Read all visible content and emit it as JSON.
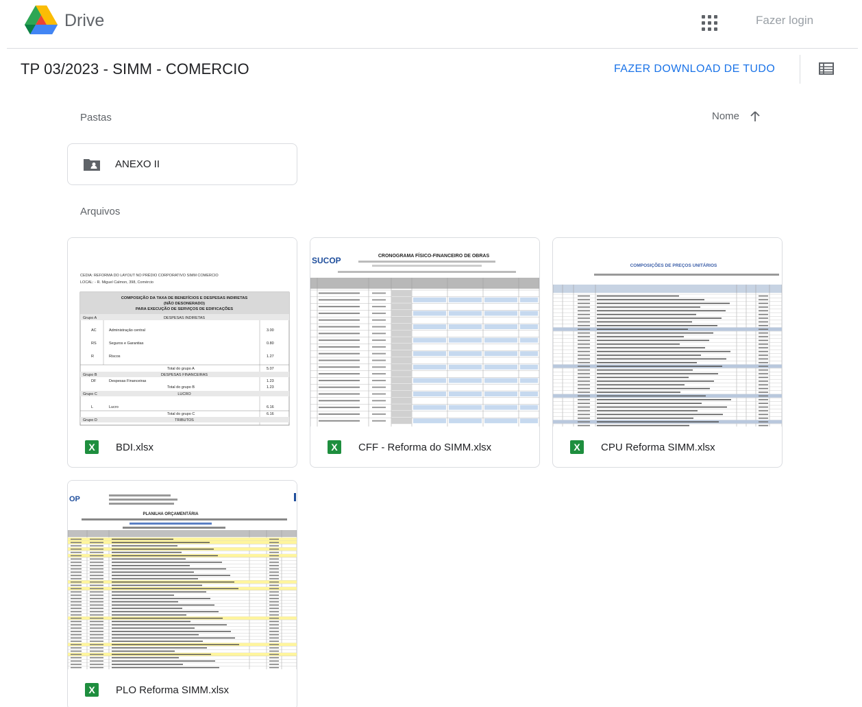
{
  "header": {
    "brand": "Drive",
    "login": "Fazer login"
  },
  "toolbar": {
    "title": "TP 03/2023 - SIMM - COMERCIO",
    "download_all": "FAZER DOWNLOAD DE TUDO"
  },
  "sections": {
    "folders_label": "Pastas",
    "files_label": "Arquivos",
    "sort_label": "Nome"
  },
  "folders": [
    {
      "name": "ANEXO II"
    }
  ],
  "files": [
    {
      "name": "BDI.xlsx",
      "type_badge": "X",
      "preview": {
        "header_line1": "CEDIA:      REFORMA DO LAYOUT NO PRÉDIO CORPORATIVO SIMM COMERCIO",
        "header_line2": "LOCAL:    - R. Miguel Calmon, 398, Comércio",
        "title": "COMPOSIÇÃO DA TAXA DE BENEFÍCIOS E DESPESAS INDIRETAS (NÃO DESONERADO) PARA EXECUÇÃO DE SERVIÇOS DE EDIFICAÇÕES",
        "groups": [
          "Grupo A",
          "DESPESAS INDIRETAS",
          "Grupo B",
          "DESPESAS FINANCEIRAS",
          "Grupo C",
          "LUCRO",
          "Grupo D",
          "TRIBUTOS"
        ],
        "rows": [
          "Administração central",
          "Seguros e Garantias",
          "Riscos",
          "Total do grupo A",
          "Despesas Financeiras",
          "Total do grupo B",
          "Lucro",
          "Total do grupo C"
        ],
        "values": [
          "3.00",
          "0.80",
          "1.27",
          "5.07",
          "1.23",
          "1.23",
          "6.16",
          "6.16"
        ]
      }
    },
    {
      "name": "CFF - Reforma do SIMM.xlsx",
      "type_badge": "X",
      "preview": {
        "logo": "SUCOP",
        "title": "CRONOGRAMA FÍSICO-FINANCEIRO DE OBRAS"
      }
    },
    {
      "name": "CPU Reforma SIMM.xlsx",
      "type_badge": "X",
      "preview": {
        "title": "COMPOSIÇÕES DE PREÇOS UNITÁRIOS"
      }
    },
    {
      "name": "PLO Reforma SIMM.xlsx",
      "type_badge": "X",
      "preview": {
        "logo": "OP",
        "title": "PLANILHA ORÇAMENTÁRIA"
      }
    }
  ],
  "colors": {
    "accent": "#1a73e8",
    "excel_green": "#1e8e3e",
    "grid_blue": "#c6d9ef",
    "highlight_yellow": "#fff59d"
  }
}
